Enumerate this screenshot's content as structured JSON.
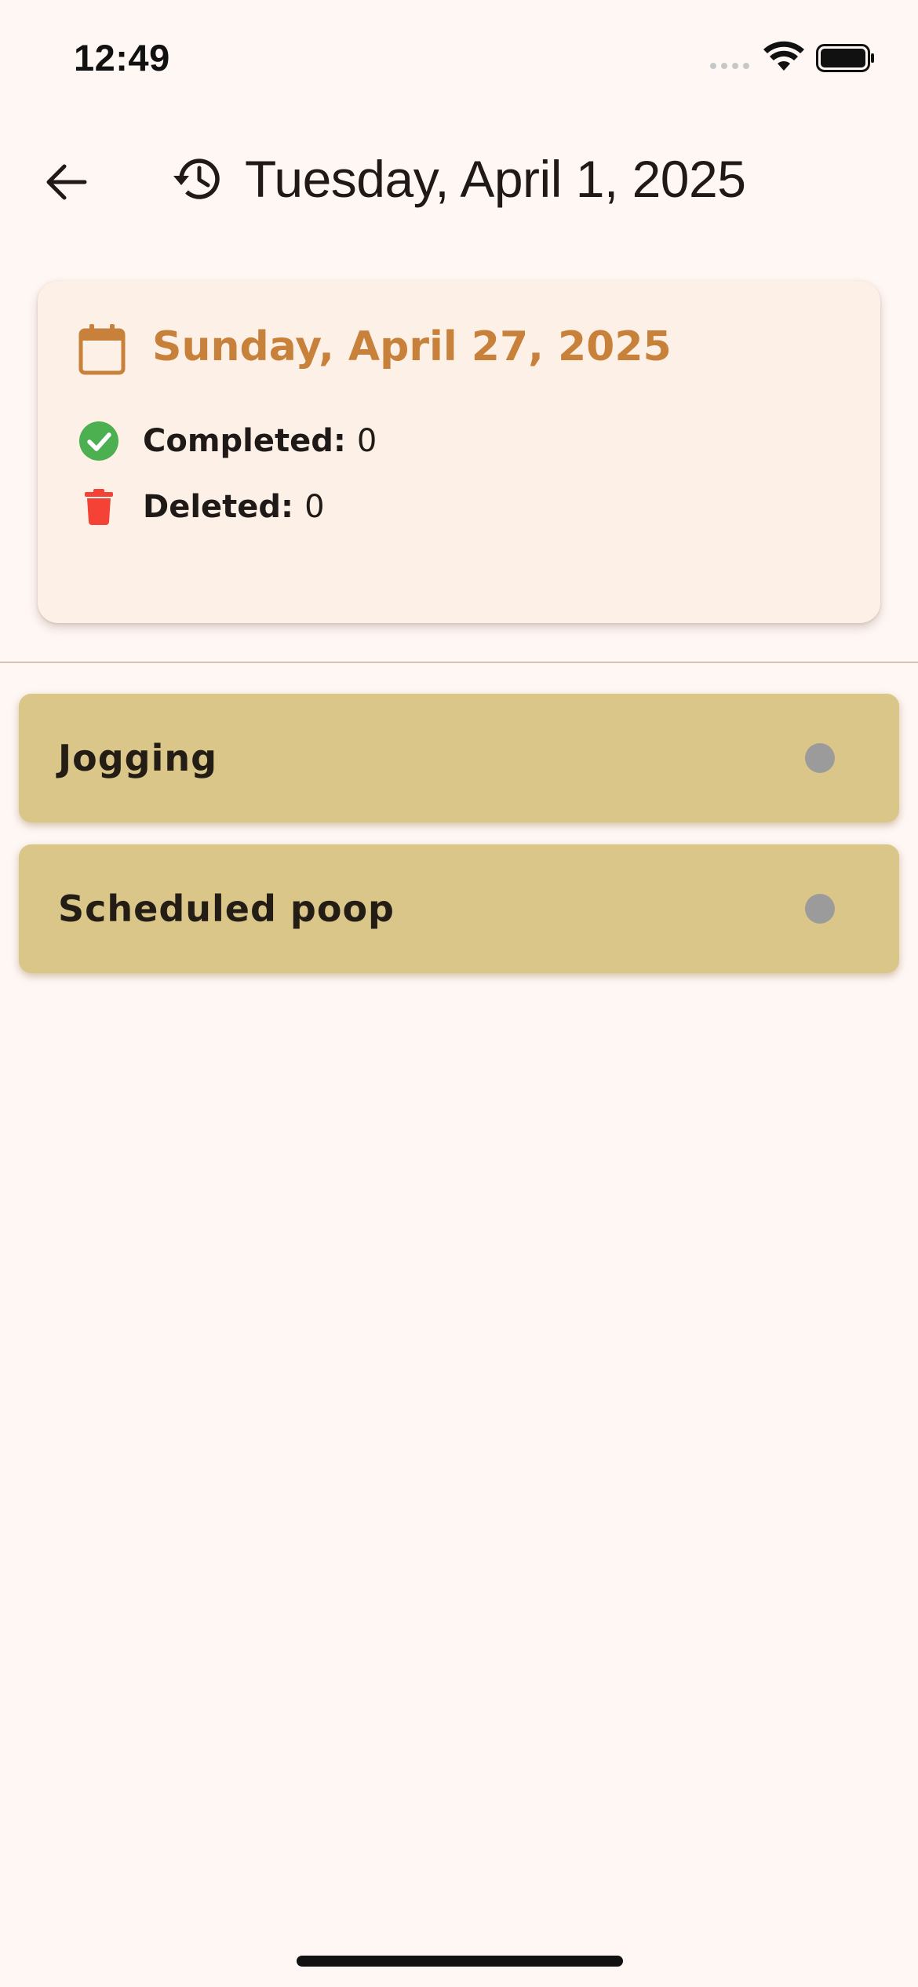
{
  "status_bar": {
    "time": "12:49"
  },
  "header": {
    "title": "Tuesday, April 1, 2025",
    "back_icon": "arrow-left-icon",
    "history_icon": "history-icon"
  },
  "summary": {
    "date": "Sunday, April 27, 2025",
    "date_color": "#c8813a",
    "completed_label": "Completed:",
    "completed_value": "0",
    "completed_color": "#4caf50",
    "deleted_label": "Deleted:",
    "deleted_value": "0",
    "deleted_color": "#f44336"
  },
  "habits": [
    {
      "name": "Jogging",
      "status_color": "#9b9b9b"
    },
    {
      "name": "Scheduled poop",
      "status_color": "#9b9b9b"
    }
  ],
  "colors": {
    "background": "#fff7f4",
    "card_background": "#fdf0e7",
    "habit_card": "#dac689"
  }
}
